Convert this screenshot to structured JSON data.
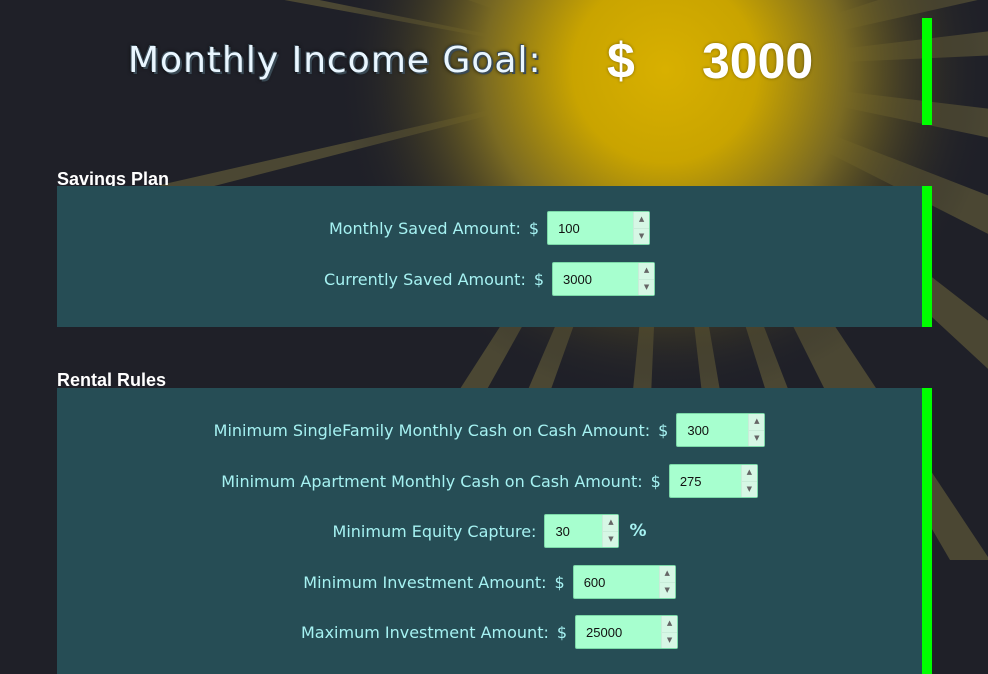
{
  "header": {
    "title": "Monthly Income Goal:",
    "currency": "$",
    "goal_value": "3000"
  },
  "savings": {
    "heading": "Savings Plan",
    "fields": [
      {
        "label": "Monthly Saved Amount:",
        "prefix": "$",
        "value": "100"
      },
      {
        "label": "Currently Saved Amount:",
        "prefix": "$",
        "value": "3000"
      }
    ]
  },
  "rental": {
    "heading": "Rental Rules",
    "fields": [
      {
        "label": "Minimum SingleFamily Monthly Cash on Cash Amount:",
        "prefix": "$",
        "value": "300"
      },
      {
        "label": "Minimum Apartment Monthly Cash on Cash Amount:",
        "prefix": "$",
        "value": "275"
      },
      {
        "label": "Minimum Equity Capture:",
        "value": "30",
        "suffix": "%"
      },
      {
        "label": "Minimum Investment Amount:",
        "prefix": "$",
        "value": "600"
      },
      {
        "label": "Maximum Investment Amount:",
        "prefix": "$",
        "value": "25000"
      }
    ]
  },
  "icons": {
    "spinner_up": "triangle-up-icon",
    "spinner_down": "triangle-down-icon"
  },
  "colors": {
    "background": "#1f2028",
    "panel": "#264d55",
    "label_text": "#a6f2f2",
    "input_bg": "#a7ffcf",
    "accent_bar": "#00ff00",
    "glow": "#c9a800"
  }
}
